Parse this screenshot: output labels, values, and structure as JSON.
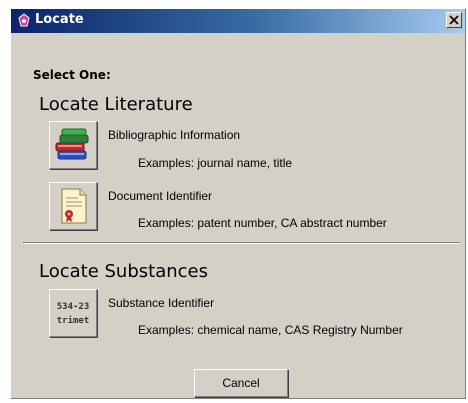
{
  "window": {
    "title": "Locate",
    "close_glyph": "X"
  },
  "prompt": "Select One:",
  "literature": {
    "heading": "Locate Literature",
    "options": [
      {
        "label": "Bibliographic Information",
        "example": "Examples: journal name, title",
        "icon": "books-icon"
      },
      {
        "label": "Document Identifier",
        "example": "Examples: patent number, CA abstract number",
        "icon": "document-certificate-icon"
      }
    ]
  },
  "substances": {
    "heading": "Locate Substances",
    "options": [
      {
        "label": "Substance Identifier",
        "example": "Examples: chemical name, CAS Registry Number",
        "icon": "substance-identifier-icon",
        "icon_text_top": "534-23",
        "icon_text_bottom": "trimet"
      }
    ]
  },
  "cancel_label": "Cancel",
  "colors": {
    "title_bar_start": "#0a246a",
    "title_bar_end": "#a6caf0",
    "dialog_bg": "#d4d0c8"
  }
}
